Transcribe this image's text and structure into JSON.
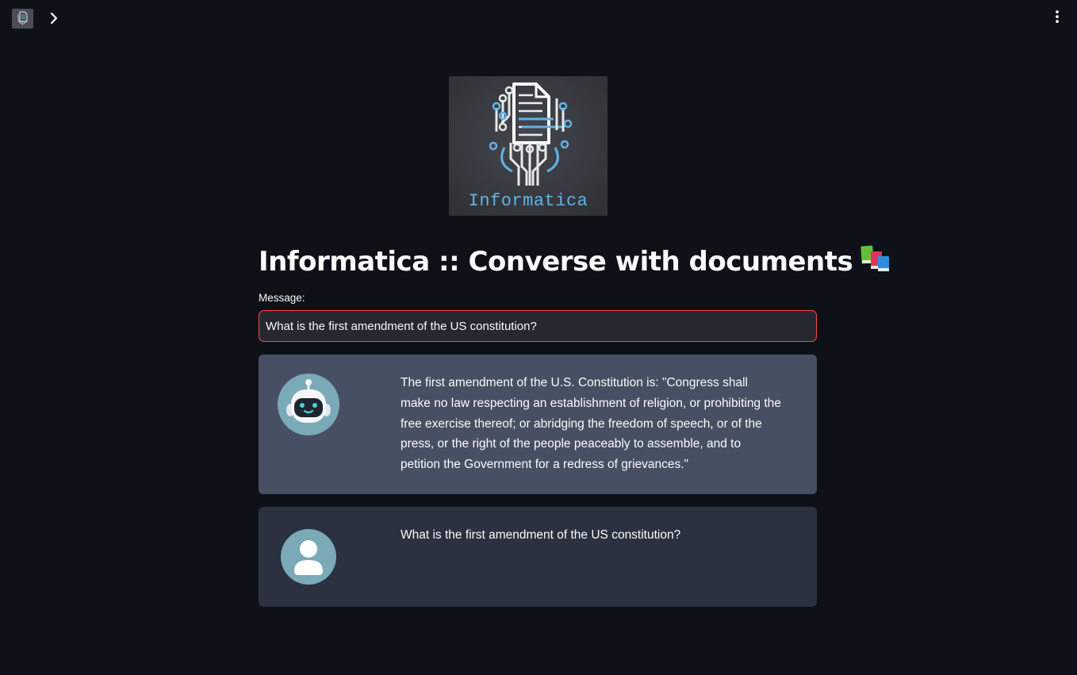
{
  "topbar": {
    "app_thumb_icon": "informatica-logo-thumbnail",
    "sidebar_toggle_icon": "chevron-right-icon",
    "menu_icon": "vertical-dots-icon"
  },
  "logo": {
    "caption": "Informatica",
    "icon": "circuit-document-brain-icon",
    "caption_color": "#5fb3e6"
  },
  "page": {
    "title": "Informatica :: Converse with documents",
    "title_icon": "books-emoji"
  },
  "input": {
    "label": "Message:",
    "value": "What is the first amendment of the US constitution?",
    "border_color": "#ff4b4b"
  },
  "chat": {
    "messages": [
      {
        "role": "bot",
        "avatar_icon": "robot-avatar-icon",
        "text": "The first amendment of the U.S. Constitution is: \"Congress shall make no law respecting an establishment of religion, or prohibiting the free exercise thereof; or abridging the freedom of speech, or of the press, or the right of the people peaceably to assemble, and to petition the Government for a redress of grievances.\""
      },
      {
        "role": "user",
        "avatar_icon": "user-avatar-icon",
        "text": "What is the first amendment of the US constitution?"
      }
    ]
  },
  "colors": {
    "background": "#0e1117",
    "bot_card": "#475063",
    "user_card": "#2b313e",
    "input_bg": "#262730"
  }
}
